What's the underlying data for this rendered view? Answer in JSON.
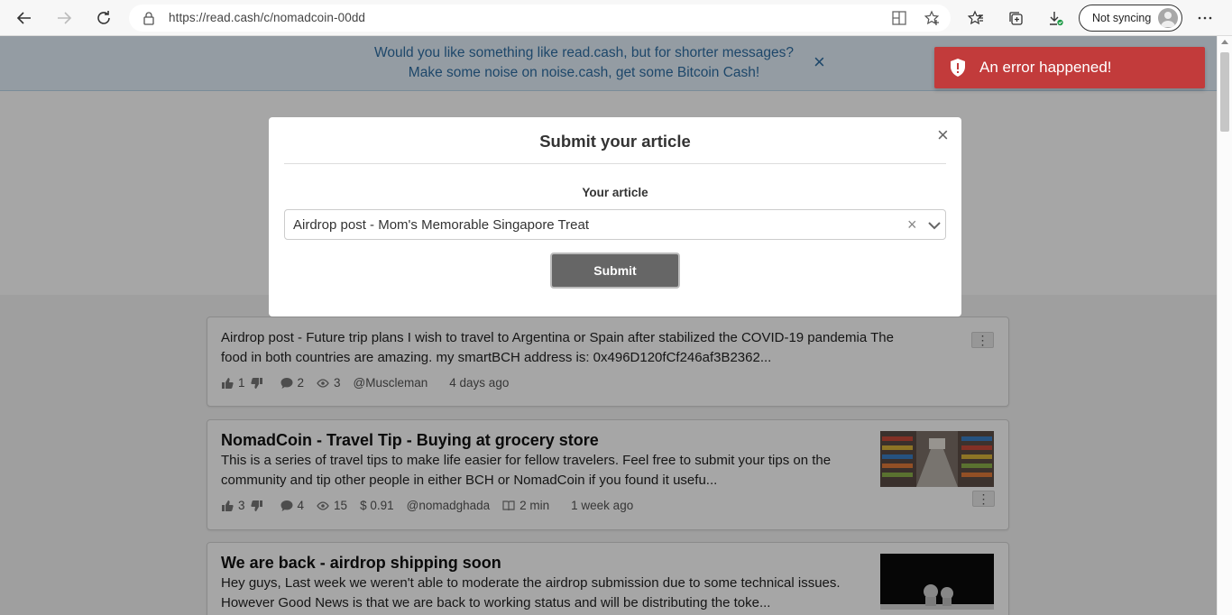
{
  "browser": {
    "url": "https://read.cash/c/nomadcoin-00dd",
    "sync_label": "Not syncing"
  },
  "notice": {
    "line1": "Would you like something like read.cash, but for shorter messages?",
    "line2": "Make some noise on noise.cash, get some Bitcoin Cash!",
    "close": "×"
  },
  "modal": {
    "title": "Submit your article",
    "close": "×",
    "field_label": "Your article",
    "selected": "Airdrop post - Mom's Memorable Singapore Treat",
    "clear": "×",
    "submit_label": "Submit"
  },
  "toast": {
    "message": "An error happened!"
  },
  "articles": [
    {
      "title": "",
      "desc1": "Airdrop post - Future trip plans I wish to travel to Argentina or Spain after stabilized the COVID-19 pandemia The",
      "desc2": "food in both countries are amazing. my smartBCH address is: 0x496D120fCf246af3B2362...",
      "likes": "1",
      "comments": "2",
      "views": "3",
      "author": "@Muscleman",
      "age": "4 days ago"
    },
    {
      "title": "NomadCoin - Travel Tip - Buying at grocery store",
      "desc1": "This is a series of travel tips to make life easier for fellow travelers. Feel free to submit your tips on the",
      "desc2": "community and tip other people in either BCH or NomadCoin if you found it usefu...",
      "likes": "3",
      "comments": "4",
      "views": "15",
      "earned": "$ 0.91",
      "author": "@nomadghada",
      "read_time": "2 min",
      "age": "1 week ago"
    },
    {
      "title": "We are back - airdrop shipping soon",
      "desc1": "Hey guys, Last week we weren't able to moderate the airdrop submission due to some technical issues.",
      "desc2": "However Good News is that we are back to working status and will be distributing the toke..."
    }
  ],
  "colors": {
    "toast": "#c23b3b",
    "notice_text": "#2e6ea3",
    "submit": "#666666"
  }
}
